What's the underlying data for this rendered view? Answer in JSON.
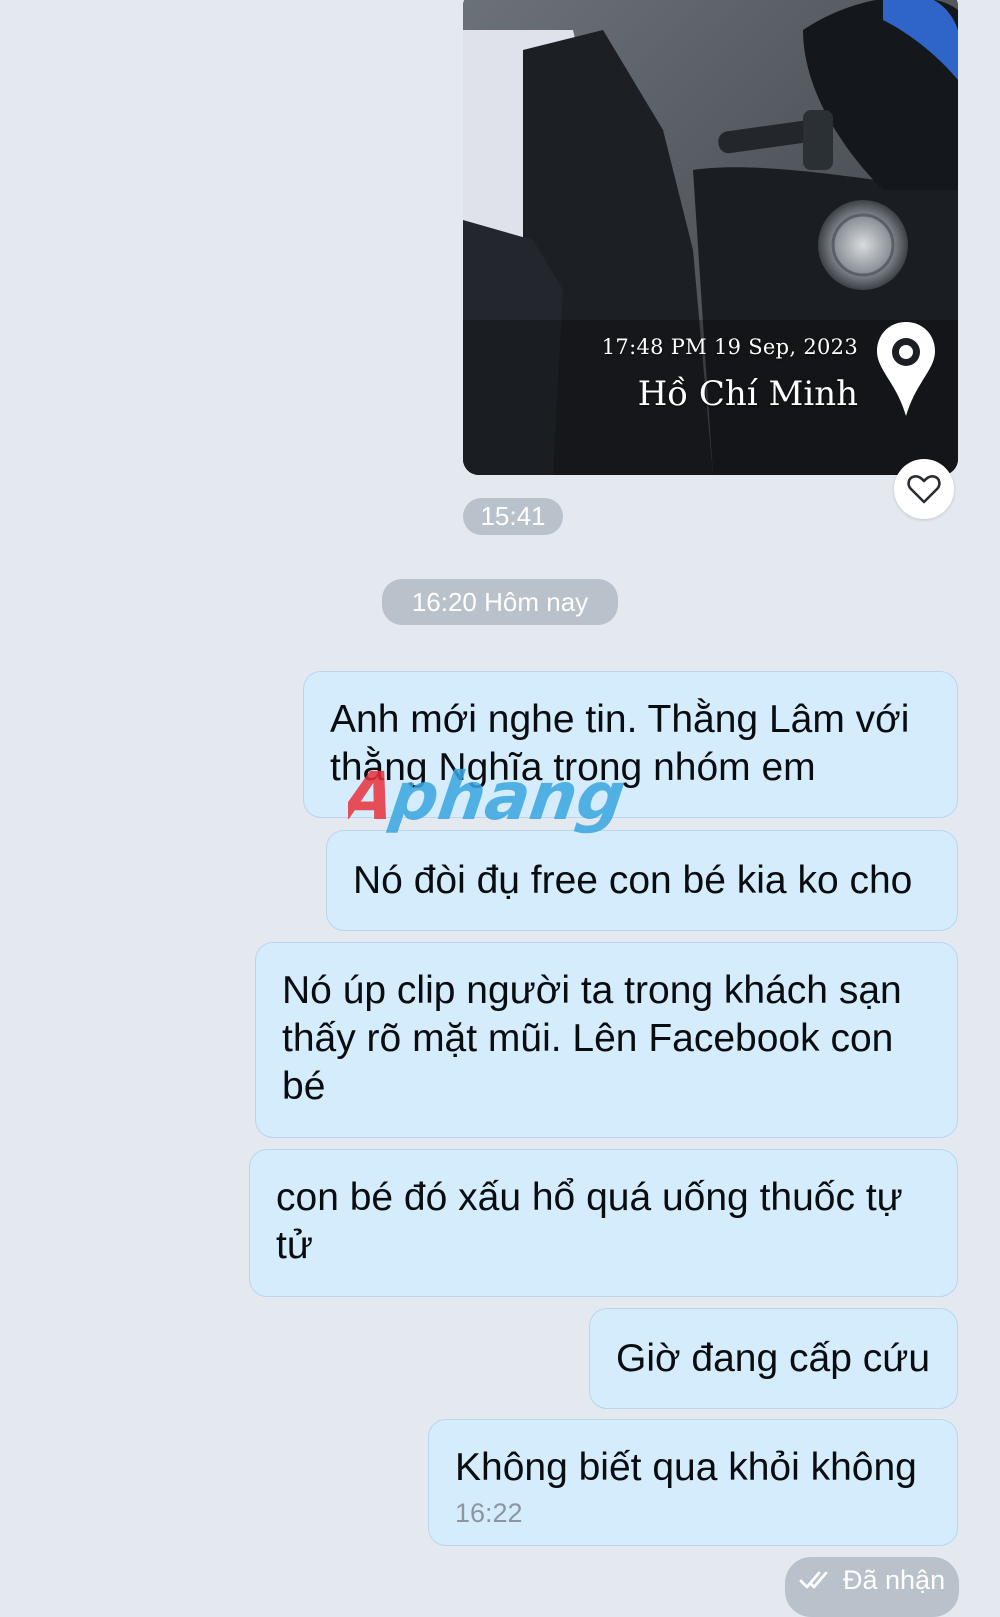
{
  "photo": {
    "timestamp_text": "17:48 PM 19 Sep, 2023",
    "location_text": "Hồ Chí Minh",
    "sent_time": "15:41"
  },
  "icons": {
    "like": "heart-outline-icon",
    "location": "map-pin-icon",
    "status": "double-check-icon"
  },
  "date_separator": "16:20 Hôm nay",
  "messages": [
    {
      "text": "Anh mới nghe tin. Thằng Lâm với thằng Nghĩa trong nhóm em"
    },
    {
      "text": "Nó đòi đụ free con bé kia ko cho"
    },
    {
      "text": "Nó úp clip người ta trong khách sạn thấy rõ mặt mũi. Lên Facebook con bé"
    },
    {
      "text": "con bé đó xấu hổ quá uống thuốc tự tử"
    },
    {
      "text": "Giờ đang cấp cứu"
    },
    {
      "text": "Không biết qua khỏi không",
      "time": "16:22"
    }
  ],
  "watermark": "Aphang",
  "delivery_status": "Đã nhận",
  "colors": {
    "background": "#e4e9f0",
    "bubble": "#d4ecfc",
    "bubble_border": "#b9d6ed",
    "pill": "#b9c1cb",
    "watermark_red": "#e8323c",
    "watermark_blue": "#3aa6e0"
  }
}
